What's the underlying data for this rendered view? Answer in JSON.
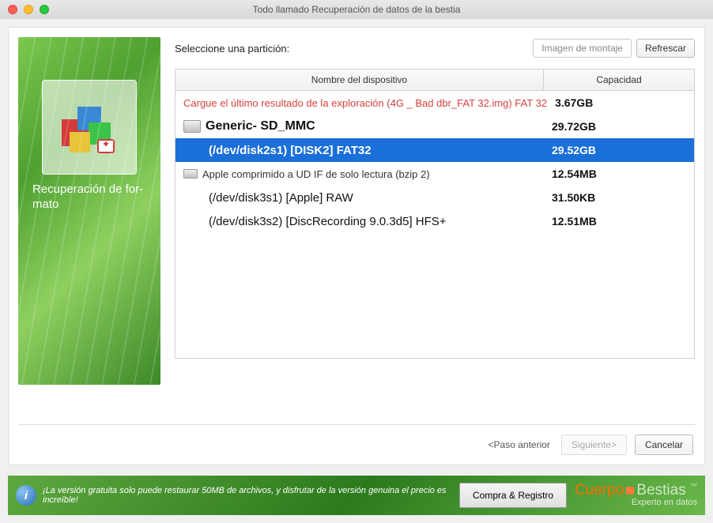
{
  "window": {
    "title": "Todo llamado Recuperación de datos de la bestia"
  },
  "sidebar": {
    "label": "Recuperación de for­mato"
  },
  "main": {
    "prompt": "Seleccione una partición:",
    "buttons": {
      "mount": "Imagen de montaje",
      "refresh": "Refrescar"
    }
  },
  "table": {
    "headers": {
      "name": "Nombre del dispositivo",
      "capacity": "Capacidad"
    },
    "rows": [
      {
        "name": "Cargue el último resultado de la exploración (4G _ Bad dbr_FAT 32.img) FAT 32",
        "cap": "3.67GB",
        "indent": 0,
        "icon": false,
        "cls": "row0"
      },
      {
        "name": "Generic- SD_MMC",
        "cap": "29.72GB",
        "indent": 0,
        "icon": true,
        "cls": "row1"
      },
      {
        "name": "(/dev/disk2s1) [DISK2] FAT32",
        "cap": "29.52GB",
        "indent": 1,
        "icon": false,
        "cls": "row2",
        "selected": true
      },
      {
        "name": "Apple comprimido a UD IF de solo lectura (bzip 2)",
        "cap": "12.54MB",
        "indent": 0,
        "icon": true,
        "cls": "row3",
        "small": true
      },
      {
        "name": "(/dev/disk3s1) [Apple] RAW",
        "cap": "31.50KB",
        "indent": 1,
        "icon": false,
        "cls": "row4"
      },
      {
        "name": "(/dev/disk3s2) [DiscRecording 9.0.3d5] HFS+",
        "cap": "12.51MB",
        "indent": 1,
        "icon": false,
        "cls": "row5"
      }
    ]
  },
  "nav": {
    "prev": "<Paso anterior",
    "next": "Siguiente>",
    "cancel": "Cancelar"
  },
  "footer": {
    "msg": "¡La versión gratuita solo puede restaurar 50MB de archivos, y disfrutar de la versión genuina el precio es increíble!",
    "buy": "Compra & Registro",
    "brand_a": "Cuer­po",
    "brand_b": "Bestias",
    "tm": "™",
    "sub": "Experto en datos"
  }
}
